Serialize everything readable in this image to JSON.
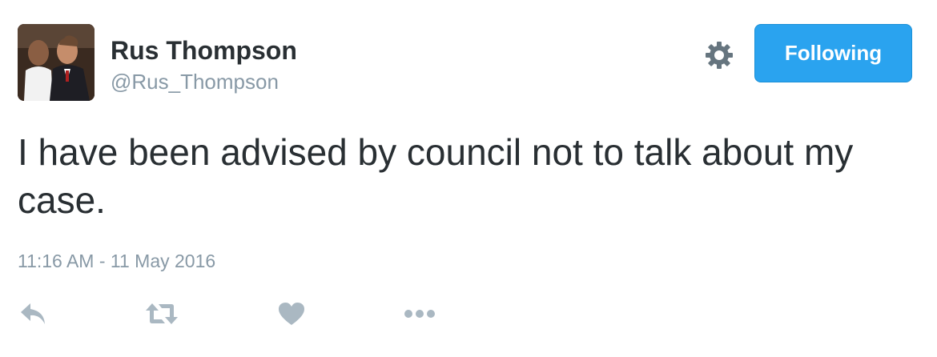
{
  "user": {
    "name": "Rus Thompson",
    "handle": "@Rus_Thompson",
    "avatar_icon": "profile-photo"
  },
  "header": {
    "settings_icon": "gear-icon",
    "follow_label": "Following"
  },
  "tweet": {
    "text": "I have been advised by council not to talk about my case.",
    "timestamp": "11:16 AM - 11 May 2016"
  },
  "actions": {
    "reply_icon": "reply-icon",
    "retweet_icon": "retweet-icon",
    "like_icon": "heart-icon",
    "more_icon": "more-dots-icon"
  },
  "colors": {
    "accent": "#2aa3ef",
    "text": "#292f33",
    "muted": "#8899a6",
    "icon": "#aab8c2"
  }
}
